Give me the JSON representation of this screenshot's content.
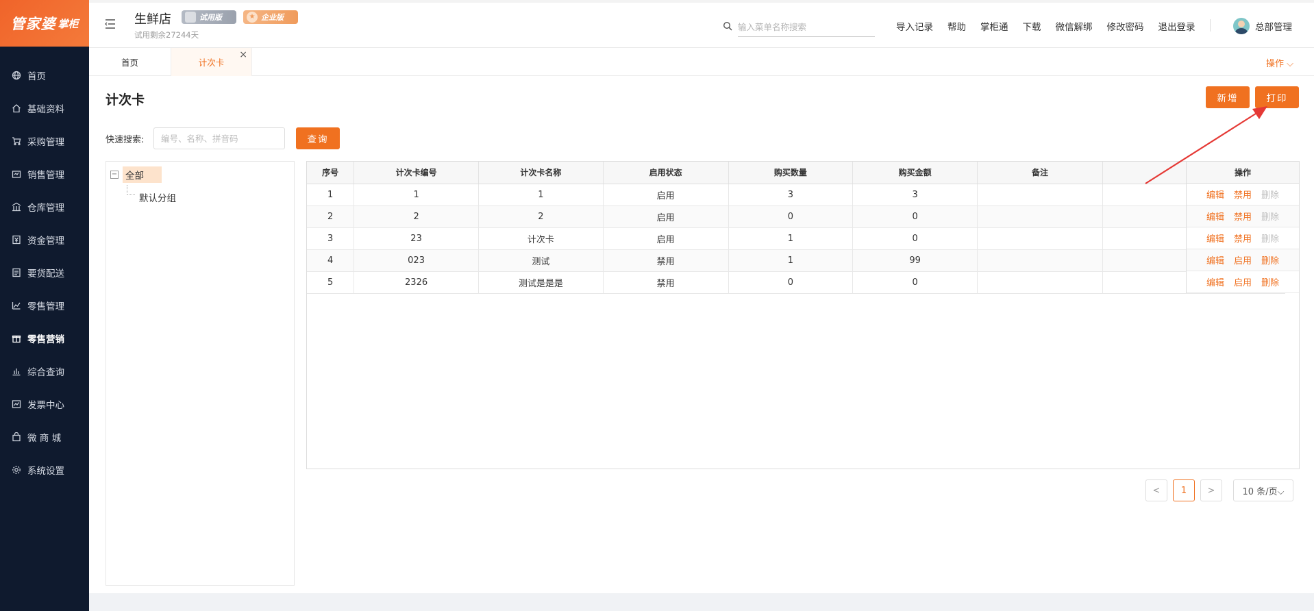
{
  "sidebar": {
    "logo_main": "管家婆",
    "logo_sub": "掌柜",
    "items": [
      {
        "label": "首页",
        "icon": "globe-icon"
      },
      {
        "label": "基础资料",
        "icon": "home-icon"
      },
      {
        "label": "采购管理",
        "icon": "cart-icon"
      },
      {
        "label": "销售管理",
        "icon": "sales-icon"
      },
      {
        "label": "仓库管理",
        "icon": "warehouse-icon"
      },
      {
        "label": "资金管理",
        "icon": "finance-icon"
      },
      {
        "label": "要货配送",
        "icon": "delivery-icon"
      },
      {
        "label": "零售管理",
        "icon": "retail-icon"
      },
      {
        "label": "零售营销",
        "icon": "gift-icon",
        "active": true
      },
      {
        "label": "综合查询",
        "icon": "chart-icon"
      },
      {
        "label": "发票中心",
        "icon": "invoice-icon"
      },
      {
        "label": "微 商 城",
        "icon": "shop-bag-icon"
      },
      {
        "label": "系统设置",
        "icon": "settings-icon"
      }
    ]
  },
  "header": {
    "store_name": "生鲜店",
    "badge_trial": "试用版",
    "badge_enterprise": "企业版",
    "trial_days": "试用剩余27244天",
    "search_placeholder": "输入菜单名称搜索",
    "links": [
      "导入记录",
      "帮助",
      "掌柜通",
      "下载",
      "微信解绑",
      "修改密码",
      "退出登录"
    ],
    "user_name": "总部管理"
  },
  "tabs": {
    "home": "首页",
    "active": "计次卡",
    "close": "×",
    "operations": "操作 ⌵"
  },
  "page": {
    "title": "计次卡",
    "add_button": "新增",
    "print_button": "打印",
    "quick_search_label": "快速搜索:",
    "quick_search_placeholder": "编号、名称、拼音码",
    "query_button": "查询"
  },
  "tree": {
    "toggle": "−",
    "root": "全部",
    "child": "默认分组"
  },
  "table": {
    "headers": [
      "序号",
      "计次卡编号",
      "计次卡名称",
      "启用状态",
      "购买数量",
      "购买金额",
      "备注"
    ],
    "op_header": "操作",
    "rows": [
      {
        "cells": [
          "1",
          "1",
          "1",
          "启用",
          "3",
          "3",
          ""
        ],
        "ops": [
          "编辑",
          "禁用",
          "删除"
        ],
        "delete_enabled": false
      },
      {
        "cells": [
          "2",
          "2",
          "2",
          "启用",
          "0",
          "0",
          ""
        ],
        "ops": [
          "编辑",
          "禁用",
          "删除"
        ],
        "delete_enabled": false
      },
      {
        "cells": [
          "3",
          "23",
          "计次卡",
          "启用",
          "1",
          "0",
          ""
        ],
        "ops": [
          "编辑",
          "禁用",
          "删除"
        ],
        "delete_enabled": false
      },
      {
        "cells": [
          "4",
          "023",
          "测试",
          "禁用",
          "1",
          "99",
          ""
        ],
        "ops": [
          "编辑",
          "启用",
          "删除"
        ],
        "delete_enabled": true
      },
      {
        "cells": [
          "5",
          "2326",
          "测试是是是",
          "禁用",
          "0",
          "0",
          ""
        ],
        "ops": [
          "编辑",
          "启用",
          "删除"
        ],
        "delete_enabled": true
      }
    ]
  },
  "pagination": {
    "prev": "<",
    "current": "1",
    "next": ">",
    "page_size": "10 条/页⌵"
  },
  "colors": {
    "accent": "#f07120",
    "sidebar_bg": "#0f1a2e",
    "annotation_arrow": "#e53935"
  }
}
